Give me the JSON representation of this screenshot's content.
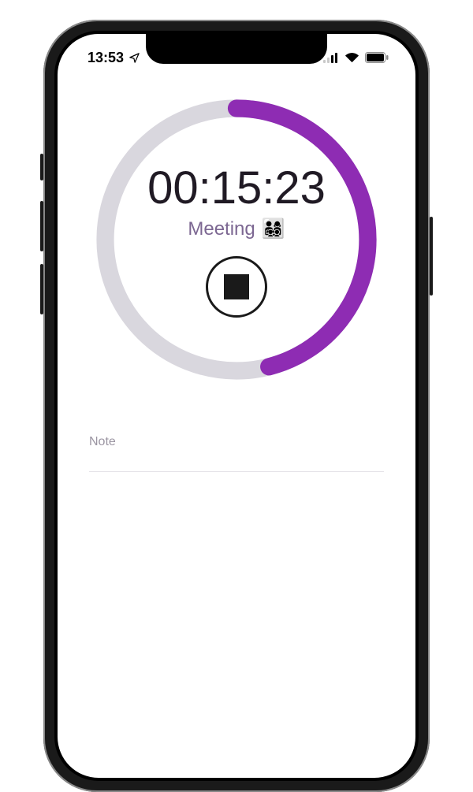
{
  "status": {
    "time": "13:53",
    "location_icon": "location-arrow",
    "signal_icon": "cellular",
    "wifi_icon": "wifi",
    "battery_icon": "battery-full"
  },
  "timer": {
    "elapsed": "00:15:23",
    "task_label": "Meeting",
    "task_emoji": "👨‍👩‍👧‍👦",
    "progress_fraction": 0.46,
    "ring_bg_color": "#d9d7de",
    "ring_fg_color": "#8e2cb3",
    "stop_icon": "stop"
  },
  "note": {
    "placeholder": "Note"
  }
}
